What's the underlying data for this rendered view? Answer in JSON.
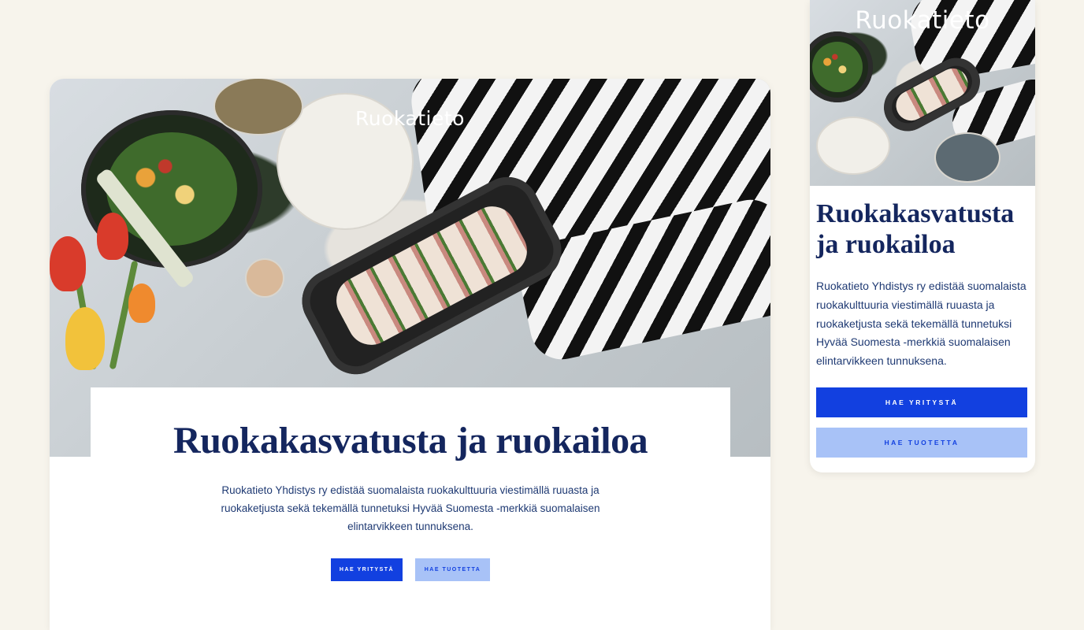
{
  "brand": {
    "logo_text": "Ruokatieto"
  },
  "hero": {
    "title": "Ruokakasvatusta ja ruokailoa",
    "description": "Ruokatieto Yhdistys ry edistää suomalaista ruokakulttuuria viestimällä ruuasta ja ruokaketjusta sekä tekemällä tunnetuksi Hyvää Suomesta -merkkiä suomalaisen elintarvikkeen tunnuksena.",
    "button_primary": "Hae yritystä",
    "button_secondary": "Hae tuotetta"
  },
  "colors": {
    "background": "#f7f4ec",
    "title": "#14265e",
    "primary_button": "#1240e0",
    "secondary_button": "#a8c2f7"
  },
  "icons": [
    "food-photo"
  ]
}
